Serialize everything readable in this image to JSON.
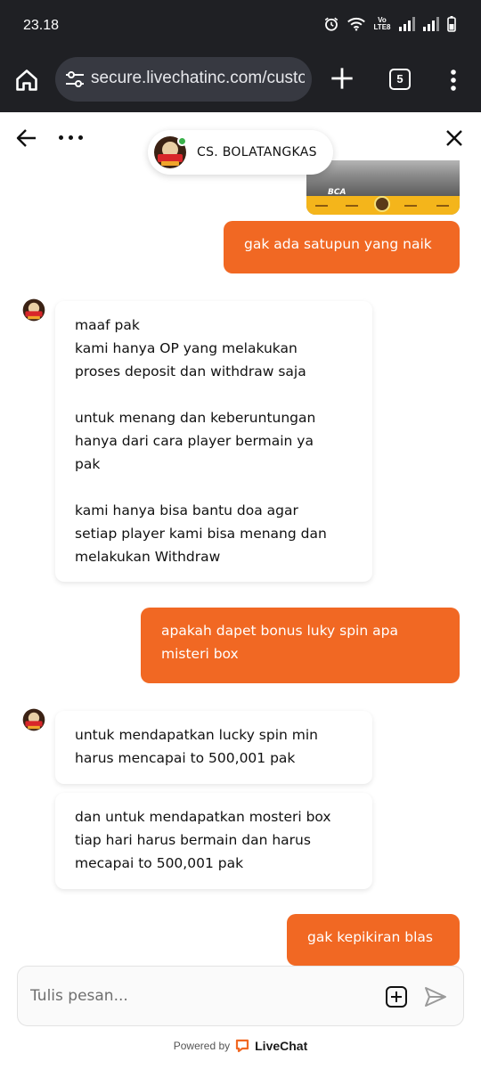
{
  "status_bar": {
    "time": "23.18",
    "network_label": "Vo LTE8"
  },
  "browser": {
    "url": "secure.livechatinc.com/customer",
    "tab_count": "5"
  },
  "chat_header": {
    "agent_name": "CS. BOLATANGKAS",
    "agent_online": true
  },
  "attachment_image": {
    "visible_text": "BCA"
  },
  "messages": [
    {
      "from": "customer",
      "text": "gak ada satupun yang naik"
    },
    {
      "from": "agent",
      "text": "maaf pak\nkami hanya OP yang melakukan\nproses deposit dan withdraw saja\n\nuntuk menang dan keberuntungan\nhanya dari cara player bermain ya\npak\n\nkami hanya bisa bantu doa agar\nsetiap player kami bisa menang dan\nmelakukan Withdraw"
    },
    {
      "from": "customer",
      "text": "apakah dapet bonus luky spin apa\nmisteri box"
    },
    {
      "from": "agent",
      "text": "untuk mendapatkan lucky spin min\nharus mencapai to 500,001 pak"
    },
    {
      "from": "agent",
      "text": "dan untuk mendapatkan mosteri box\ntiap hari harus bermain dan harus\nmecapai to 500,001 pak"
    },
    {
      "from": "customer",
      "text": "gak kepikiran blas"
    }
  ],
  "composer": {
    "placeholder": "Tulis pesan..."
  },
  "footer": {
    "powered_by": "Powered by",
    "brand": "LiveChat"
  },
  "colors": {
    "accent": "#f16823",
    "online": "#3ab14b",
    "browser_bar": "#1f2024"
  }
}
